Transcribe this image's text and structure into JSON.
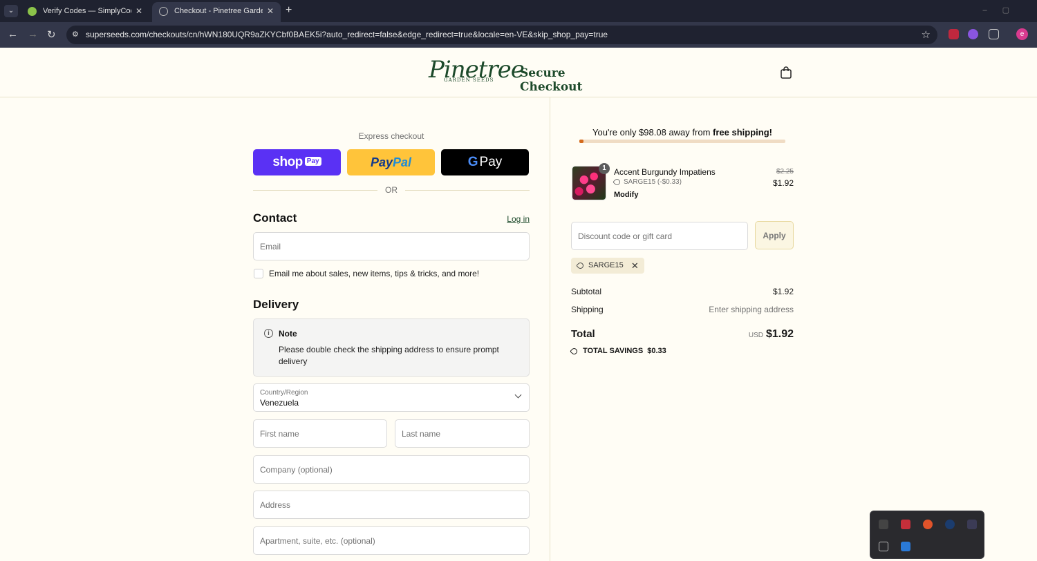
{
  "browser": {
    "tabs": [
      {
        "title": "Verify Codes — SimplyCodes",
        "active": false
      },
      {
        "title": "Checkout - Pinetree Garden Seeds",
        "active": true
      }
    ],
    "url": "superseeds.com/checkouts/cn/hWN180UQR9aZKYCbf0BAEK5i?auto_redirect=false&edge_redirect=true&locale=en-VE&skip_shop_pay=true",
    "profile_initial": "e"
  },
  "header": {
    "logo_script": "Pinetree",
    "logo_sub": "GARDEN SEEDS",
    "secure_checkout": "Secure Checkout"
  },
  "express": {
    "label": "Express checkout",
    "shop_pay_word": "shop",
    "shop_pay_badge": "Pay",
    "paypal_pay": "Pay",
    "paypal_pal": "Pal",
    "gpay_g": "G",
    "gpay_word": "Pay",
    "or": "OR"
  },
  "contact": {
    "title": "Contact",
    "login": "Log in",
    "email_placeholder": "Email",
    "marketing_label": "Email me about sales, new items, tips & tricks, and more!"
  },
  "delivery": {
    "title": "Delivery",
    "note_title": "Note",
    "note_text": "Please double check the shipping address to ensure prompt delivery",
    "country_label": "Country/Region",
    "country_value": "Venezuela",
    "first_name_placeholder": "First name",
    "last_name_placeholder": "Last name",
    "company_placeholder": "Company (optional)",
    "address_placeholder": "Address",
    "apartment_placeholder": "Apartment, suite, etc. (optional)"
  },
  "summary": {
    "ship_msg_prefix": "You're only $98.08 away from ",
    "ship_msg_bold": "free shipping!",
    "free_shipping_progress": 0.02,
    "product": {
      "quantity": "1",
      "name": "Accent Burgundy Impatiens",
      "discount": "SARGE15 (-$0.33)",
      "modify": "Modify",
      "price_old": "$2.25",
      "price_new": "$1.92"
    },
    "discount_placeholder": "Discount code or gift card",
    "apply": "Apply",
    "applied_code": "SARGE15",
    "subtotal_label": "Subtotal",
    "subtotal_value": "$1.92",
    "shipping_label": "Shipping",
    "shipping_value": "Enter shipping address",
    "total_label": "Total",
    "total_currency": "USD",
    "total_value": "$1.92",
    "savings_label": "TOTAL SAVINGS",
    "savings_value": "$0.33"
  },
  "colors": {
    "brand_green": "#1d4a2b",
    "shop_pay": "#5a31f4",
    "paypal": "#ffc43a",
    "progress": "#d46a1c"
  }
}
